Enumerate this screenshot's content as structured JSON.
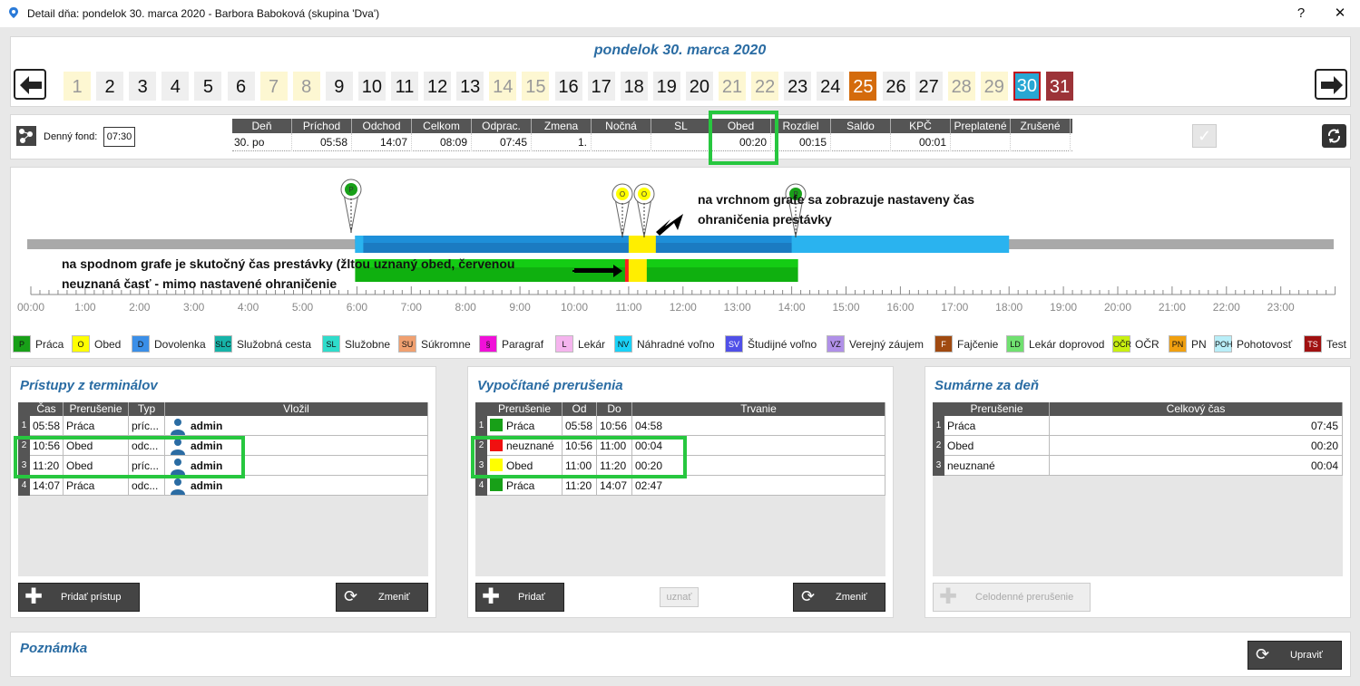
{
  "window": {
    "title": "Detail dňa: pondelok 30. marca 2020 -  Barbora Baboková  (skupina 'Dva')",
    "help": "?",
    "close": "✕"
  },
  "date_title": "pondelok 30. marca 2020",
  "days": [
    "1",
    "2",
    "3",
    "4",
    "5",
    "6",
    "7",
    "8",
    "9",
    "10",
    "11",
    "12",
    "13",
    "14",
    "15",
    "16",
    "17",
    "18",
    "19",
    "20",
    "21",
    "22",
    "23",
    "24",
    "25",
    "26",
    "27",
    "28",
    "29",
    "30",
    "31"
  ],
  "fund": {
    "label": "Denný fond:",
    "value": "07:30"
  },
  "summary": {
    "headers": [
      "Deň",
      "Príchod",
      "Odchod",
      "Celkom",
      "Odprac.",
      "Zmena",
      "Nočná",
      "SL",
      "Obed",
      "Rozdiel",
      "Saldo",
      "KPČ",
      "Preplatené",
      "Zrušené"
    ],
    "row": [
      "30. po",
      "05:58",
      "14:07",
      "08:09",
      "07:45",
      "1.",
      "",
      "",
      "00:20",
      "00:15",
      "",
      "00:01",
      "",
      ""
    ]
  },
  "timeline": {
    "pin_labels": [
      "P",
      "O",
      "O",
      "P"
    ],
    "hours": [
      "00:00",
      "1:00",
      "2:00",
      "3:00",
      "4:00",
      "5:00",
      "6:00",
      "7:00",
      "8:00",
      "9:00",
      "10:00",
      "11:00",
      "12:00",
      "13:00",
      "14:00",
      "15:00",
      "16:00",
      "17:00",
      "18:00",
      "19:00",
      "20:00",
      "21:00",
      "22:00",
      "23:00"
    ],
    "annotation_top": [
      "na vrchnom grafe sa zobrazuje nastaveny čas",
      "ohraničenia prestávky"
    ],
    "annotation_bottom": [
      "na spodnom grafe je skutočný čas prestávky (žltou uznaný obed, červenou",
      "neuznaná časť - mimo nastavené ohraničenie"
    ]
  },
  "legend": [
    {
      "code": "P",
      "label": "Práca",
      "color": "#18a018"
    },
    {
      "code": "O",
      "label": "Obed",
      "color": "#ffff00"
    },
    {
      "code": "D",
      "label": "Dovolenka",
      "color": "#3b8fe8"
    },
    {
      "code": "SLC",
      "label": "Služobná cesta",
      "color": "#16b3a8"
    },
    {
      "code": "SL",
      "label": "Služobne",
      "color": "#2fdccb"
    },
    {
      "code": "SU",
      "label": "Súkromne",
      "color": "#f0a070"
    },
    {
      "code": "§",
      "label": "Paragraf",
      "color": "#f010d8"
    },
    {
      "code": "L",
      "label": "Lekár",
      "color": "#f5b4ee"
    },
    {
      "code": "NV",
      "label": "Náhradné voľno",
      "color": "#1ad2f7"
    },
    {
      "code": "SV",
      "label": "Študijné voľno",
      "color": "#5050e8"
    },
    {
      "code": "VZ",
      "label": "Verejný záujem",
      "color": "#b090e8"
    },
    {
      "code": "F",
      "label": "Fajčenie",
      "color": "#a04a10"
    },
    {
      "code": "LD",
      "label": "Lekár doprovod",
      "color": "#70e070"
    },
    {
      "code": "OČR",
      "label": "OČR",
      "color": "#c8f010"
    },
    {
      "code": "PN",
      "label": "PN",
      "color": "#f0a010"
    },
    {
      "code": "POH",
      "label": "Pohotovosť",
      "color": "#b8eef8"
    },
    {
      "code": "TS",
      "label": "Test",
      "color": "#a01010"
    }
  ],
  "terminal": {
    "title": "Prístupy z terminálov",
    "headers": [
      "Čas",
      "Prerušenie",
      "Typ",
      "Vložil"
    ],
    "rows": [
      {
        "n": "1",
        "time": "05:58",
        "type": "Práca",
        "kind": "príc...",
        "by": "admin"
      },
      {
        "n": "2",
        "time": "10:56",
        "type": "Obed",
        "kind": "odc...",
        "by": "admin"
      },
      {
        "n": "3",
        "time": "11:20",
        "type": "Obed",
        "kind": "príc...",
        "by": "admin"
      },
      {
        "n": "4",
        "time": "14:07",
        "type": "Práca",
        "kind": "odc...",
        "by": "admin"
      }
    ],
    "add": "Pridať prístup",
    "change": "Zmeniť"
  },
  "computed": {
    "title": "Vypočítané prerušenia",
    "headers": [
      "Prerušenie",
      "Od",
      "Do",
      "Trvanie"
    ],
    "rows": [
      {
        "n": "1",
        "type": "Práca",
        "from": "05:58",
        "to": "10:56",
        "dur": "04:58",
        "color": "#18a018"
      },
      {
        "n": "2",
        "type": "neuznané",
        "from": "10:56",
        "to": "11:00",
        "dur": "00:04",
        "color": "#f01010"
      },
      {
        "n": "3",
        "type": "Obed",
        "from": "11:00",
        "to": "11:20",
        "dur": "00:20",
        "color": "#ffff00"
      },
      {
        "n": "4",
        "type": "Práca",
        "from": "11:20",
        "to": "14:07",
        "dur": "02:47",
        "color": "#18a018"
      }
    ],
    "add": "Pridať",
    "accept": "uznať",
    "change": "Zmeniť"
  },
  "daysum": {
    "title": "Sumárne za deň",
    "headers": [
      "Prerušenie",
      "Celkový čas"
    ],
    "rows": [
      {
        "n": "1",
        "type": "Práca",
        "total": "07:45"
      },
      {
        "n": "2",
        "type": "Obed",
        "total": "00:20"
      },
      {
        "n": "3",
        "type": "neuznané",
        "total": "00:04"
      }
    ],
    "fullday": "Celodenné prerušenie"
  },
  "note": {
    "title": "Poznámka",
    "edit": "Upraviť"
  }
}
